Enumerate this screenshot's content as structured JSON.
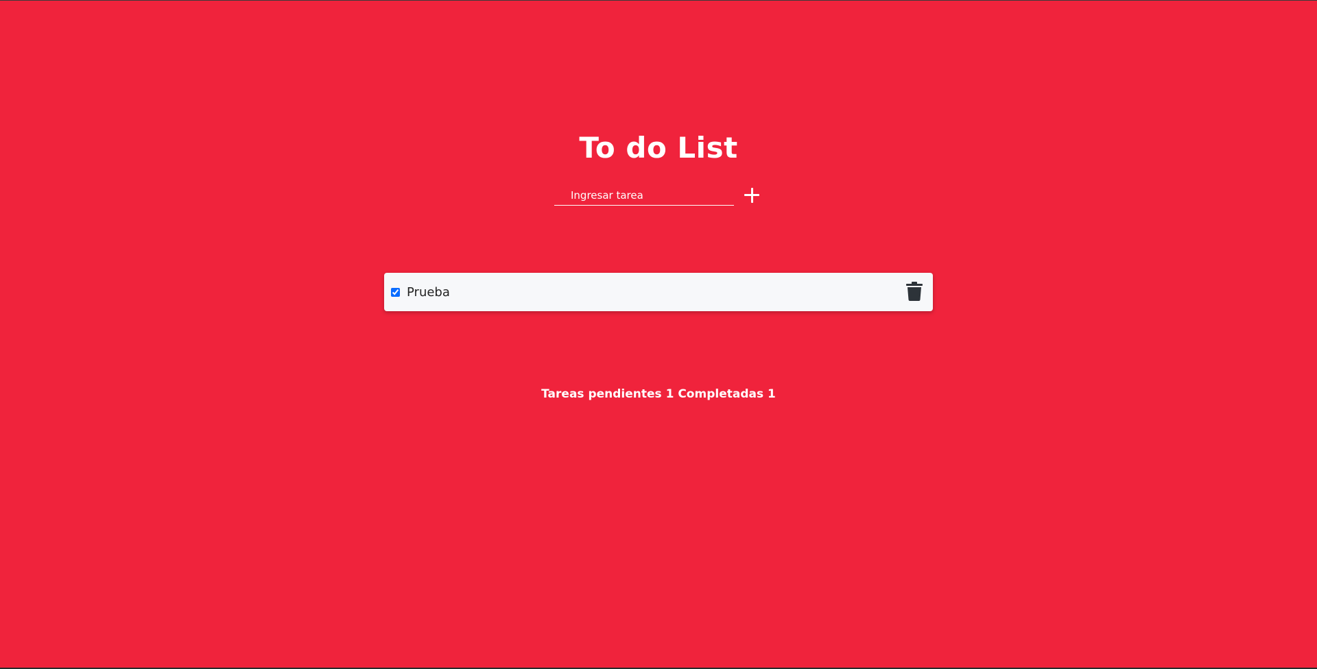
{
  "app": {
    "title": "To do List"
  },
  "new_task": {
    "placeholder": "Ingresar tarea",
    "value": "",
    "add_icon": "plus-icon"
  },
  "tasks": [
    {
      "label": "Prueba",
      "completed": true,
      "delete_icon": "trash-icon"
    }
  ],
  "status": {
    "text": "Tareas pendientes 1 Completadas 1"
  },
  "colors": {
    "background": "#f0233c",
    "card": "#f7f8fa",
    "text_light": "#ffffff",
    "icon_dark": "#2d3339"
  }
}
